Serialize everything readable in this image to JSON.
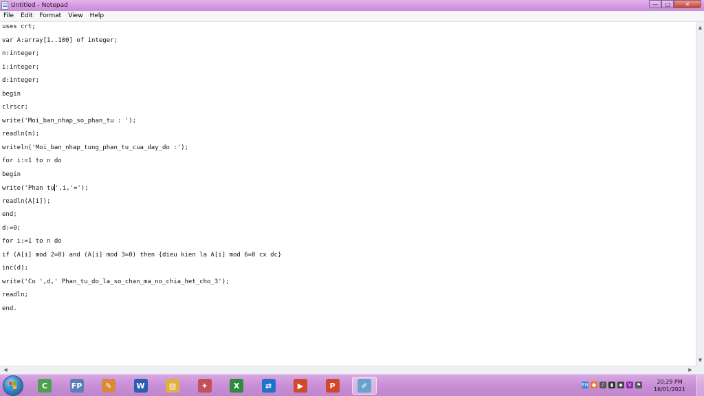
{
  "window": {
    "title": "Untitled - Notepad",
    "controls": {
      "minimize": "—",
      "maximize": "□",
      "close": "✕"
    }
  },
  "menu": [
    "File",
    "Edit",
    "Format",
    "View",
    "Help"
  ],
  "editor": {
    "lines": [
      "uses crt;",
      "var A:array[1..100] of integer;",
      "n:integer;",
      "i:integer;",
      "d:integer;",
      "begin",
      "clrscr;",
      "write('Moi_ban_nhap_so_phan_tu : ');",
      "readln(n);",
      "writeln('Moi_ban_nhap_tung_phan_tu_cua_day_do :');",
      "for i:=1 to n do",
      "begin",
      "write('Phan tu',i,'=');",
      "readln(A[i]);",
      "end;",
      "d:=0;",
      "for i:=1 to n do",
      "if (A[i] mod 2=0) and (A[i] mod 3=0) then {dieu kien la A[i] mod 6=0 cx dc}",
      "inc(d);",
      "write('Co ',d,' Phan_tu_do_la_so_chan_ma_no_chia_het_cho_3');",
      "readln;",
      "end."
    ],
    "caret_line": 12,
    "caret_col": 14
  },
  "taskbar": {
    "apps": [
      {
        "name": "cc-cleaner-icon",
        "glyph": "C",
        "color": "#4aa34a",
        "active": false
      },
      {
        "name": "free-pascal-icon",
        "glyph": "FP",
        "color": "#5b7fb8",
        "active": false
      },
      {
        "name": "paint-icon",
        "glyph": "✎",
        "color": "#d9893a",
        "active": false
      },
      {
        "name": "word-icon",
        "glyph": "W",
        "color": "#2b5eb0",
        "active": false
      },
      {
        "name": "file-explorer-icon",
        "glyph": "▤",
        "color": "#e0b13e",
        "active": false
      },
      {
        "name": "puzzle-app-icon",
        "glyph": "✦",
        "color": "#c4515a",
        "active": false
      },
      {
        "name": "excel-icon",
        "glyph": "X",
        "color": "#2f8a3e",
        "active": false
      },
      {
        "name": "teamviewer-icon",
        "glyph": "⇄",
        "color": "#1f73c9",
        "active": false
      },
      {
        "name": "media-player-icon",
        "glyph": "▶",
        "color": "#d04a2a",
        "active": false
      },
      {
        "name": "powerpoint-icon",
        "glyph": "P",
        "color": "#d24726",
        "active": false
      },
      {
        "name": "notepad-icon",
        "glyph": "✐",
        "color": "#6aa3c9",
        "active": true
      }
    ],
    "tray": [
      {
        "name": "language-icon",
        "glyph": "EN",
        "color": "#3a7fd0"
      },
      {
        "name": "antivirus-icon",
        "glyph": "●",
        "color": "#e37b22"
      },
      {
        "name": "volume-icon",
        "glyph": "♪",
        "color": "#555555"
      },
      {
        "name": "network-icon",
        "glyph": "▮",
        "color": "#333333"
      },
      {
        "name": "shield-icon",
        "glyph": "◆",
        "color": "#444444"
      },
      {
        "name": "v-icon",
        "glyph": "V",
        "color": "#8a2bb0"
      },
      {
        "name": "flag-icon",
        "glyph": "⚑",
        "color": "#555555"
      }
    ],
    "clock": {
      "time": "20:29 PM",
      "date": "16/01/2021"
    }
  }
}
